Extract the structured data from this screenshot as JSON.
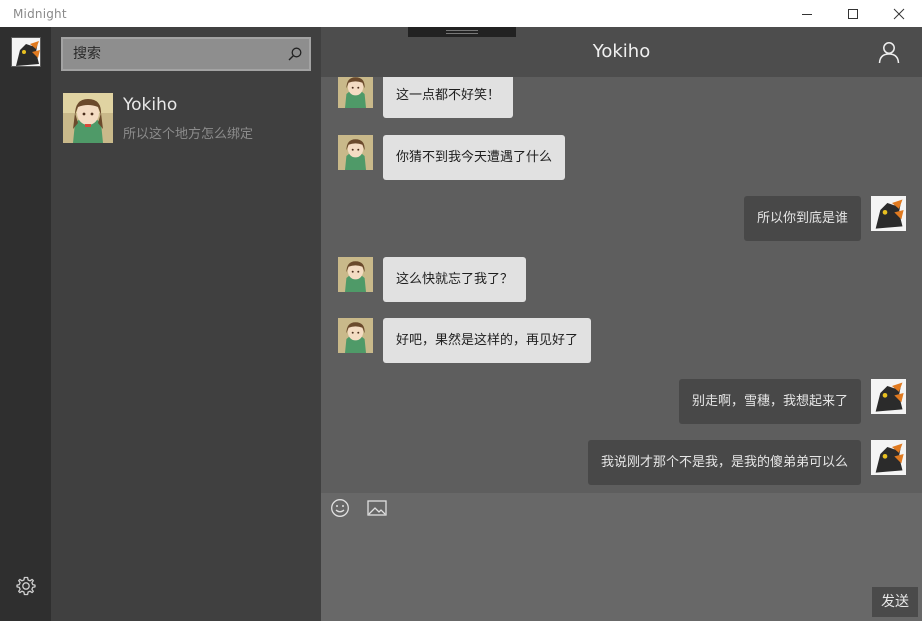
{
  "window": {
    "title": "Midnight"
  },
  "search": {
    "placeholder": "搜索"
  },
  "contacts": [
    {
      "name": "Yokiho",
      "preview": "所以这个地方怎么绑定"
    }
  ],
  "chat": {
    "title": "Yokiho",
    "messages": [
      {
        "side": "left",
        "text": "这一点都不好笑！"
      },
      {
        "side": "left",
        "text": "你猜不到我今天遭遇了什么"
      },
      {
        "side": "right",
        "text": "所以你到底是谁"
      },
      {
        "side": "left",
        "text": "这么快就忘了我了？"
      },
      {
        "side": "left",
        "text": "好吧，果然是这样的，再见好了"
      },
      {
        "side": "right",
        "text": "别走啊，雪穗，我想起来了"
      },
      {
        "side": "right",
        "text": "我说刚才那个不是我，是我的傻弟弟可以么"
      }
    ]
  },
  "composer": {
    "send_label": "发送",
    "value": ""
  },
  "icons": {
    "emoji": "emoji-icon",
    "image": "image-icon",
    "settings": "gear-icon",
    "user": "user-icon",
    "search": "search-icon"
  },
  "colors": {
    "rail": "#2f2f2f",
    "contacts": "#404040",
    "chat_bg": "#5e5e5e",
    "header": "#4d4d4d",
    "bubble_in": "#e1e1e1",
    "bubble_out": "#484848"
  }
}
